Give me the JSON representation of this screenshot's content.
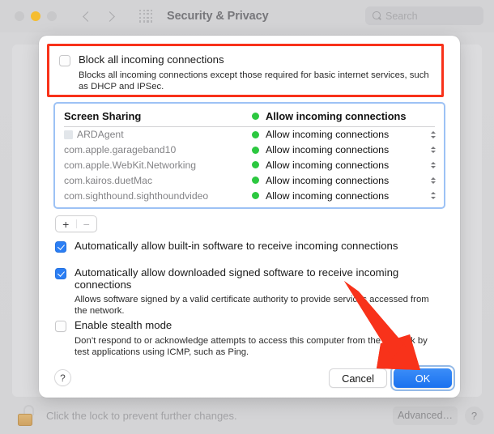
{
  "window": {
    "title": "Security & Privacy",
    "traffic_lights": [
      "close",
      "minimize",
      "zoom"
    ],
    "nav_back": "back-chevron",
    "nav_forward": "forward-chevron",
    "grid_icon": "grid-view-icon",
    "search": {
      "placeholder": "Search",
      "value": "",
      "icon": "search-icon"
    }
  },
  "sheet": {
    "block_all": {
      "label": "Block all incoming connections",
      "description": "Blocks all incoming connections except those required for basic internet services, such as DHCP and IPSec.",
      "checked": false
    },
    "table": {
      "header": {
        "name": "Screen Sharing",
        "status": "Allow incoming connections",
        "status_color": "#2cc840"
      },
      "rows": [
        {
          "name": "ARDAgent",
          "status": "Allow incoming connections",
          "status_color": "#2cc840",
          "has_icon": true
        },
        {
          "name": "com.apple.garageband10",
          "status": "Allow incoming connections",
          "status_color": "#2cc840",
          "has_icon": false
        },
        {
          "name": "com.apple.WebKit.Networking",
          "status": "Allow incoming connections",
          "status_color": "#2cc840",
          "has_icon": false
        },
        {
          "name": "com.kairos.duetMac",
          "status": "Allow incoming connections",
          "status_color": "#2cc840",
          "has_icon": false
        },
        {
          "name": "com.sighthound.sighthoundvideo",
          "status": "Allow incoming connections",
          "status_color": "#2cc840",
          "has_icon": false
        }
      ]
    },
    "add_remove": {
      "add_label": "+",
      "remove_label": "−"
    },
    "options": [
      {
        "label": "Automatically allow built-in software to receive incoming connections",
        "description": "",
        "checked": true
      },
      {
        "label": "Automatically allow downloaded signed software to receive incoming connections",
        "description": "Allows software signed by a valid certificate authority to provide services accessed from the network.",
        "checked": true
      },
      {
        "label": "Enable stealth mode",
        "description": "Don’t respond to or acknowledge attempts to access this computer from the network by test applications using ICMP, such as Ping.",
        "checked": false
      }
    ],
    "footer": {
      "help_label": "?",
      "cancel_label": "Cancel",
      "ok_label": "OK"
    }
  },
  "lock_bar": {
    "message": "Click the lock to prevent further changes.",
    "lock_icon": "unlocked-padlock-icon",
    "advanced_label": "Advanced…",
    "help_label": "?"
  },
  "annotations": {
    "highlight_color": "#f8321a",
    "rect_target": "block-all-incoming-connections-row",
    "arrow_target": "ok-button"
  }
}
